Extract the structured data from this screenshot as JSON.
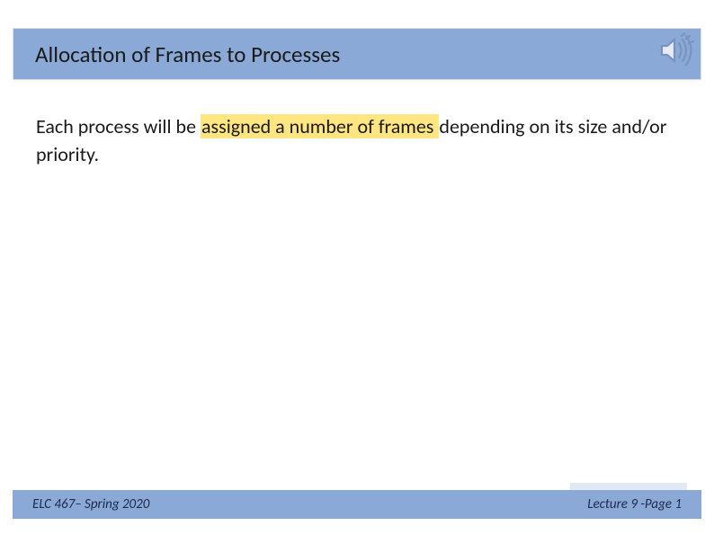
{
  "header": {
    "title": "Allocation of Frames to Processes",
    "icon": "speaker-icon"
  },
  "body": {
    "text_before": "Each process will be ",
    "highlighted": "assigned a number of frames ",
    "text_after": "depending on its size and/or priority."
  },
  "footer": {
    "left": "ELC 467– Spring 2020",
    "right": "Lecture 9 -Page 1"
  }
}
